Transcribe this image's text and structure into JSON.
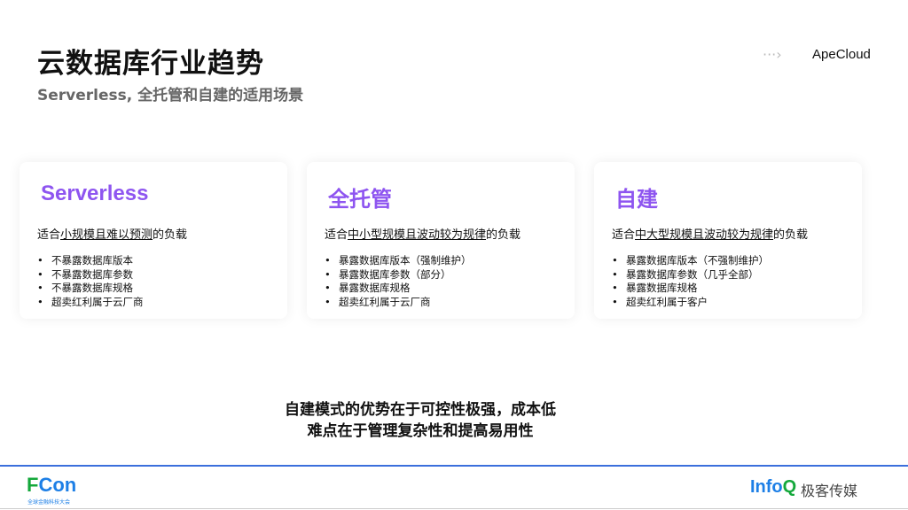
{
  "header": {
    "title": "云数据库行业趋势",
    "subtitle": "Serverless, 全托管和自建的适用场景",
    "arrow_icon": "dotted-arrow-icon",
    "brand": "ApeCloud"
  },
  "cards": [
    {
      "title": "Serverless",
      "desc_pre": "适合",
      "desc_u": "小规模且难以预测",
      "desc_post": "的负载",
      "items": [
        "不暴露数据库版本",
        "不暴露数据库参数",
        "不暴露数据库规格",
        "超卖红利属于云厂商"
      ]
    },
    {
      "title": "全托管",
      "desc_pre": "适合",
      "desc_u": "中小型规模且波动较为规律",
      "desc_post": "的负载",
      "items": [
        "暴露数据库版本（强制维护）",
        "暴露数据库参数（部分）",
        "暴露数据库规格",
        "超卖红利属于云厂商"
      ]
    },
    {
      "title": "自建",
      "desc_pre": "适合",
      "desc_u": "中大型规模且波动较为规律",
      "desc_post": "的负载",
      "items": [
        "暴露数据库版本（不强制维护）",
        "暴露数据库参数（几乎全部）",
        "暴露数据库规格",
        "超卖红利属于客户"
      ]
    }
  ],
  "note": {
    "line1": "自建模式的优势在于可控性极强，成本低",
    "line2": "难点在于管理复杂性和提高易用性"
  },
  "footer": {
    "fcon_f": "F",
    "fcon_rest": "Con",
    "fcon_sub": "全球金融科技大会",
    "infoq_main": "Info",
    "infoq_q": "Q",
    "infoq_cn": "极客传媒"
  }
}
